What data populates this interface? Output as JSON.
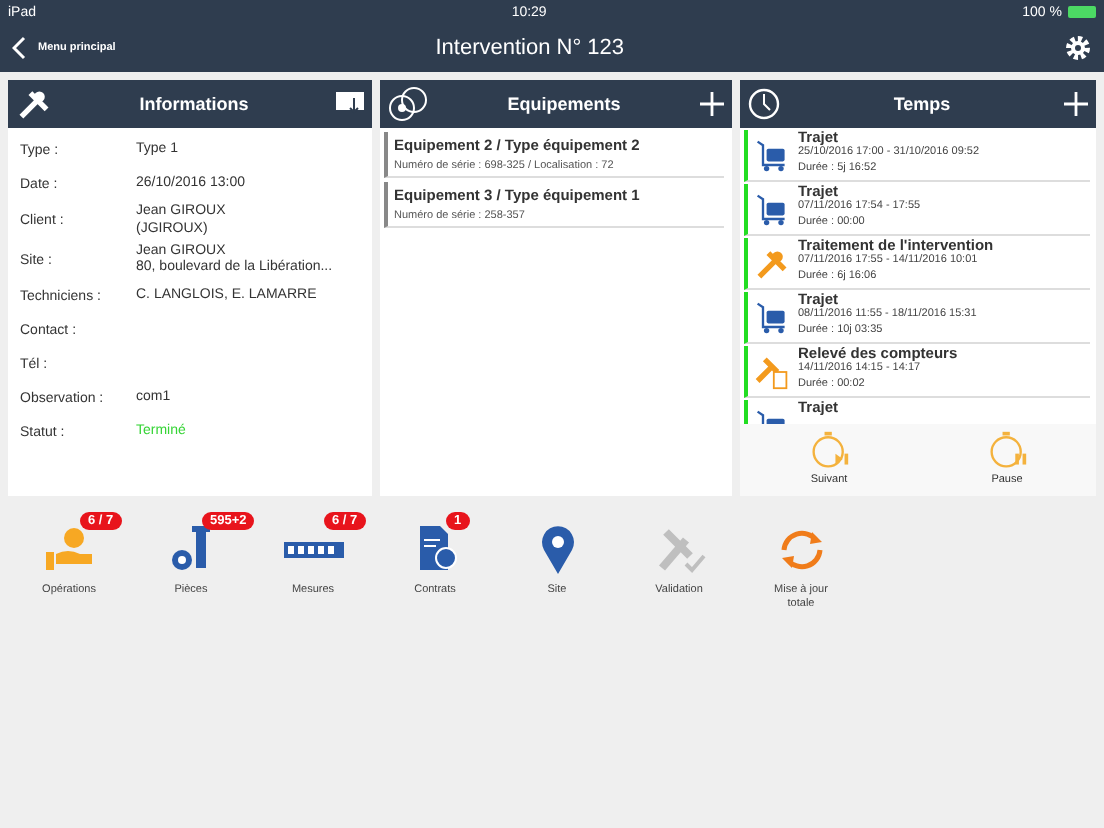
{
  "status_bar": {
    "device": "iPad",
    "time": "10:29",
    "battery": "100 %"
  },
  "nav": {
    "back_label": "Menu principal",
    "title": "Intervention N° 123"
  },
  "informations": {
    "title": "Informations",
    "fields": [
      {
        "label": "Type :",
        "value": "Type 1"
      },
      {
        "label": "Date :",
        "value": "26/10/2016 13:00"
      },
      {
        "label": "Client :",
        "value": "Jean GIROUX\n(JGIROUX)"
      },
      {
        "label": "Site :",
        "value": "Jean GIROUX\n80, boulevard de la Libération..."
      },
      {
        "label": "Techniciens :",
        "value": "C. LANGLOIS, E. LAMARRE"
      },
      {
        "label": "Contact :"
      },
      {
        "label": "Tél :"
      },
      {
        "label": "Observation :",
        "value": "com1"
      }
    ],
    "status": {
      "label": "Statut :",
      "value": "Terminé"
    }
  },
  "equipements": {
    "title": "Equipements",
    "items": [
      {
        "name": "Equipement 2 / Type équipement 2",
        "detail": "Numéro de série : 698-325 / Localisation : 72"
      },
      {
        "name": "Equipement 3 / Type équipement 1",
        "detail": "Numéro de série : 258-357"
      }
    ]
  },
  "temps": {
    "title": "Temps",
    "entries": [
      {
        "kind": "trajet",
        "title": "Trajet",
        "period": "25/10/2016 17:00 - 31/10/2016 09:52",
        "duration": "Durée : 5j 16:52"
      },
      {
        "kind": "trajet",
        "title": "Trajet",
        "period": "07/11/2016 17:54 - 17:55",
        "duration": "Durée : 00:00"
      },
      {
        "kind": "traitement",
        "title": "Traitement de l'intervention",
        "period": "07/11/2016 17:55 - 14/11/2016 10:01",
        "duration": "Durée : 6j 16:06"
      },
      {
        "kind": "trajet",
        "title": "Trajet",
        "period": "08/11/2016 11:55 - 18/11/2016 15:31",
        "duration": "Durée : 10j 03:35"
      },
      {
        "kind": "releve",
        "title": "Relevé des compteurs",
        "period": "14/11/2016 14:15 - 14:17",
        "duration": "Durée : 00:02"
      },
      {
        "kind": "trajet",
        "title": "Trajet"
      }
    ],
    "buttons": [
      {
        "kind": "next",
        "label": "Suivant"
      },
      {
        "kind": "pause",
        "label": "Pause"
      }
    ]
  },
  "toolbar": [
    {
      "kind": "operations",
      "label": "Opérations",
      "badge": "6 / 7",
      "disabled": false
    },
    {
      "kind": "pieces",
      "label": "Pièces",
      "badge": "595+2",
      "disabled": false
    },
    {
      "kind": "mesures",
      "label": "Mesures",
      "badge": "6 / 7",
      "disabled": false
    },
    {
      "kind": "contrats",
      "label": "Contrats",
      "badge": "1",
      "disabled": false
    },
    {
      "kind": "site",
      "label": "Site",
      "disabled": false
    },
    {
      "kind": "validation",
      "label": "Validation",
      "disabled": true
    },
    {
      "kind": "sync",
      "label": "Mise à jour\ntotale",
      "disabled": false
    }
  ]
}
